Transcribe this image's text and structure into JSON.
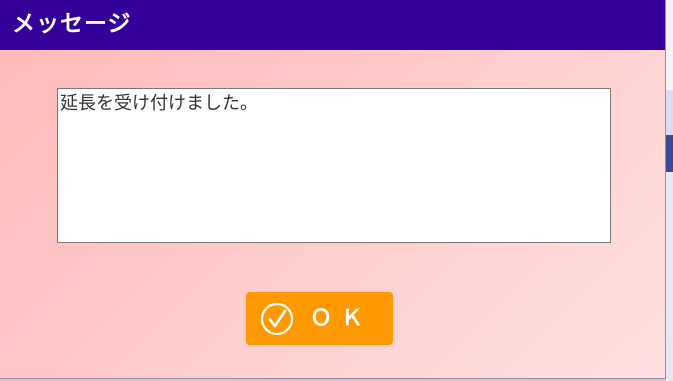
{
  "dialog": {
    "title": "メッセージ",
    "message": "延長を受け付けました。",
    "ok_label": "ＯＫ",
    "ok_icon": "check-circle-icon"
  },
  "colors": {
    "titlebar": "#330099",
    "button": "#ff9900",
    "background_start": "#ffb8b8",
    "background_end": "#ffe0e0"
  }
}
